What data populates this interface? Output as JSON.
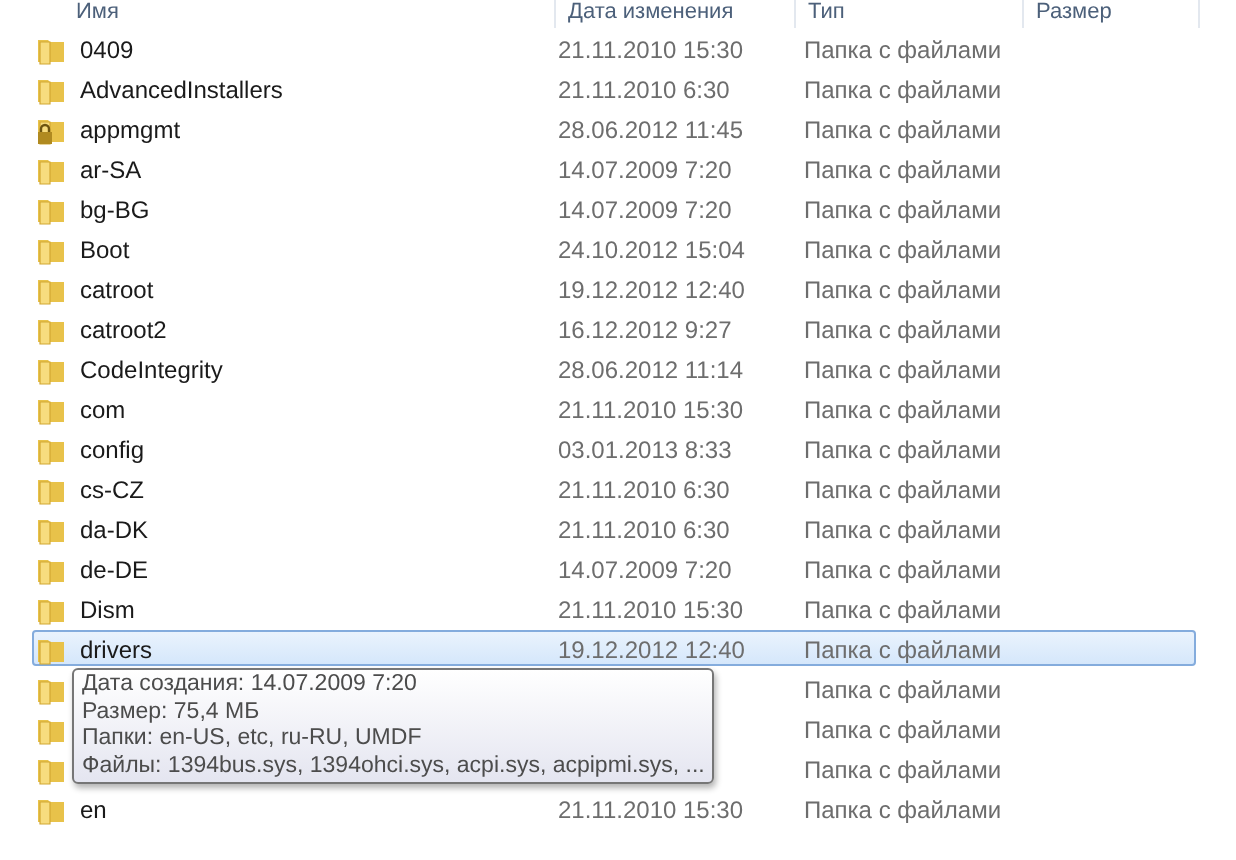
{
  "columns": [
    "Имя",
    "Дата изменения",
    "Тип",
    "Размер"
  ],
  "rows": [
    {
      "kind": "folder",
      "name": "0409",
      "date": "21.11.2010 15:30",
      "type": "Папка с файлами",
      "selected": false
    },
    {
      "kind": "folder",
      "name": "AdvancedInstallers",
      "date": "21.11.2010 6:30",
      "type": "Папка с файлами",
      "selected": false
    },
    {
      "kind": "locked",
      "name": "appmgmt",
      "date": "28.06.2012 11:45",
      "type": "Папка с файлами",
      "selected": false
    },
    {
      "kind": "folder",
      "name": "ar-SA",
      "date": "14.07.2009 7:20",
      "type": "Папка с файлами",
      "selected": false
    },
    {
      "kind": "folder",
      "name": "bg-BG",
      "date": "14.07.2009 7:20",
      "type": "Папка с файлами",
      "selected": false
    },
    {
      "kind": "folder",
      "name": "Boot",
      "date": "24.10.2012 15:04",
      "type": "Папка с файлами",
      "selected": false
    },
    {
      "kind": "folder",
      "name": "catroot",
      "date": "19.12.2012 12:40",
      "type": "Папка с файлами",
      "selected": false
    },
    {
      "kind": "folder",
      "name": "catroot2",
      "date": "16.12.2012 9:27",
      "type": "Папка с файлами",
      "selected": false
    },
    {
      "kind": "folder",
      "name": "CodeIntegrity",
      "date": "28.06.2012 11:14",
      "type": "Папка с файлами",
      "selected": false
    },
    {
      "kind": "folder",
      "name": "com",
      "date": "21.11.2010 15:30",
      "type": "Папка с файлами",
      "selected": false
    },
    {
      "kind": "folder",
      "name": "config",
      "date": "03.01.2013 8:33",
      "type": "Папка с файлами",
      "selected": false
    },
    {
      "kind": "folder",
      "name": "cs-CZ",
      "date": "21.11.2010 6:30",
      "type": "Папка с файлами",
      "selected": false
    },
    {
      "kind": "folder",
      "name": "da-DK",
      "date": "21.11.2010 6:30",
      "type": "Папка с файлами",
      "selected": false
    },
    {
      "kind": "folder",
      "name": "de-DE",
      "date": "14.07.2009 7:20",
      "type": "Папка с файлами",
      "selected": false
    },
    {
      "kind": "folder",
      "name": "Dism",
      "date": "21.11.2010 15:30",
      "type": "Папка с файлами",
      "selected": false
    },
    {
      "kind": "folder",
      "name": "drivers",
      "date": "19.12.2012 12:40",
      "type": "Папка с файлами",
      "selected": true
    },
    {
      "kind": "folder",
      "type": "Папка с файлами",
      "selected": false
    },
    {
      "kind": "folder",
      "type": "Папка с файлами",
      "selected": false
    },
    {
      "kind": "folder",
      "type": "Папка с файлами",
      "selected": false
    },
    {
      "kind": "folder",
      "name": "en",
      "date": "21.11.2010 15:30",
      "type": "Папка с файлами",
      "selected": false
    }
  ],
  "tooltip": [
    "Дата создания: 14.07.2009 7:20",
    "Размер: 75,4 МБ",
    "Папки: en-US, etc, ru-RU, UMDF",
    "Файлы: 1394bus.sys, 1394ohci.sys, acpi.sys, acpipmi.sys, ..."
  ]
}
